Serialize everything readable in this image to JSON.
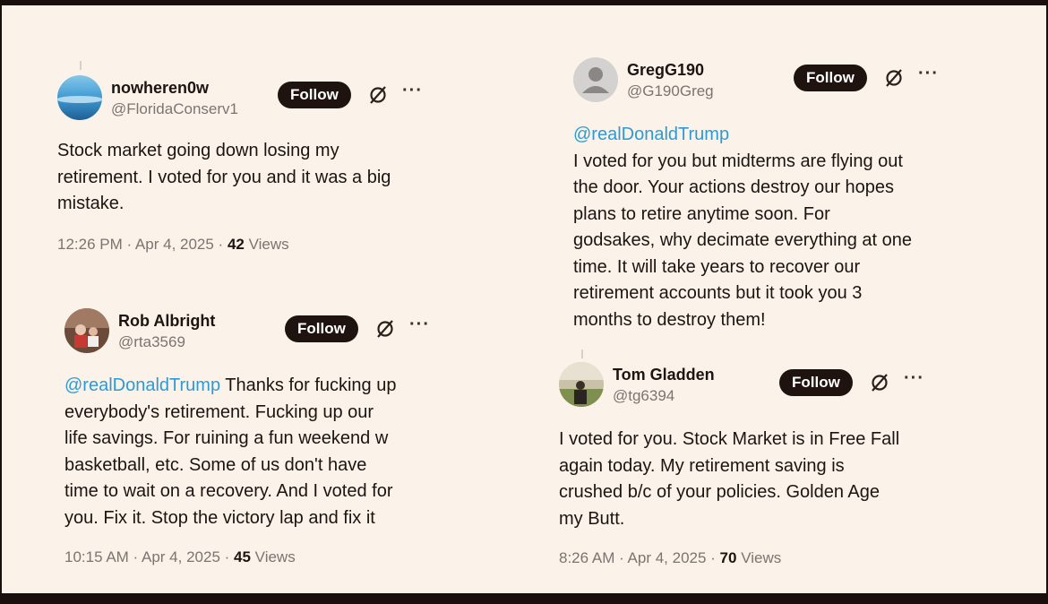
{
  "follow_label": "Follow",
  "more_label": "···",
  "tweets": [
    {
      "name": "nowheren0w",
      "handle": "@FloridaConserv1",
      "mention": "",
      "text": "Stock market going down losing my\nretirement.  I voted for you and it was a big\nmistake.",
      "time": "12:26 PM · Apr 4, 2025 · ",
      "views": "42",
      "views_label": " Views"
    },
    {
      "name": "Rob Albright",
      "handle": "@rta3569",
      "mention": "@realDonaldTrump",
      "text": " Thanks for fucking up\neverybody's retirement.   Fucking up our\nlife savings.  For ruining a fun weekend w\nbasketball, etc.  Some of us don't have\ntime to wait on a recovery.  And I voted for\nyou.   Fix it.  Stop the victory lap and fix it",
      "time": "10:15 AM · Apr 4, 2025 · ",
      "views": "45",
      "views_label": " Views"
    },
    {
      "name": "GregG190",
      "handle": "@G190Greg",
      "mention": "@realDonaldTrump",
      "text": "I voted for you but midterms are flying out\nthe door. Your actions destroy our hopes\nplans to retire anytime soon. For\ngodsakes, why decimate everything at one\ntime. It will take years to recover our\nretirement accounts but it took you 3\nmonths to destroy them!",
      "time": "",
      "views": "",
      "views_label": ""
    },
    {
      "name": "Tom Gladden",
      "handle": "@tg6394",
      "mention": "",
      "text": "I voted for you. Stock Market is in Free Fall\nagain today. My retirement saving is\ncrushed b/c of your policies. Golden Age\nmy Butt.",
      "time": "8:26 AM · Apr 4, 2025 · ",
      "views": "70",
      "views_label": " Views"
    }
  ],
  "colors": {
    "background": "#fbf3e9",
    "mention": "#2b9bd7",
    "follow_bg": "#1e130f",
    "muted": "#7b7470"
  },
  "icons": [
    "grok-icon",
    "more-icon"
  ]
}
